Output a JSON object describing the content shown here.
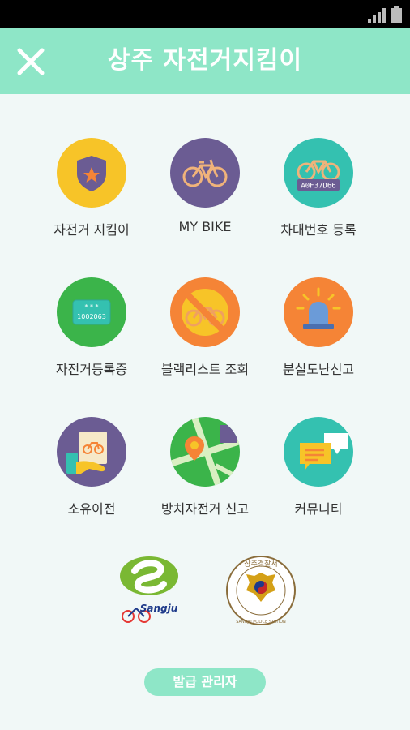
{
  "app": {
    "title": "상주 자전거지킴이"
  },
  "header": {
    "close_icon": "close-icon"
  },
  "menu": [
    {
      "label": "자전거 지킴이",
      "icon": "shield-star-icon",
      "color": "#f7c428"
    },
    {
      "label": "MY BIKE",
      "icon": "bicycle-icon",
      "color": "#6b5c93"
    },
    {
      "label": "차대번호 등록",
      "icon": "bike-frame-number-icon",
      "color": "#34c1b0",
      "frame_number": "A0F37D66"
    },
    {
      "label": "자전거등록증",
      "icon": "registration-card-icon",
      "color": "#3bb44a",
      "card_number": "1002063"
    },
    {
      "label": "블랙리스트 조회",
      "icon": "blacklist-bike-icon",
      "color": "#f58436"
    },
    {
      "label": "분실도난신고",
      "icon": "alarm-siren-icon",
      "color": "#f58436"
    },
    {
      "label": "소유이전",
      "icon": "ownership-transfer-icon",
      "color": "#6b5c93"
    },
    {
      "label": "방치자전거 신고",
      "icon": "map-pin-icon",
      "color": "#3bb44a"
    },
    {
      "label": "커뮤니티",
      "icon": "chat-bubbles-icon",
      "color": "#34c1b0"
    }
  ],
  "logos": {
    "sangju_text": "Sangju",
    "police_text_top": "상주경찰서",
    "police_text_bottom": "SANGJU POLICE STATION"
  },
  "admin_button": {
    "label": "발급 관리자"
  }
}
